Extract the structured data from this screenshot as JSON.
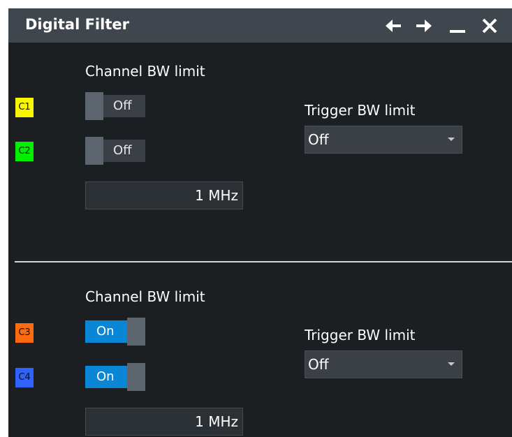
{
  "window": {
    "title": "Digital Filter",
    "icons": [
      "arrow-left-icon",
      "arrow-right-icon",
      "minimize-icon",
      "close-icon"
    ]
  },
  "colors": {
    "background": "#1c1f22",
    "titlebar": "#40464d",
    "toggle_on": "#0a86d6",
    "C1": "#f7f700",
    "C2": "#00f000",
    "C3": "#ff6a0f",
    "C4": "#2f62ff"
  },
  "groups": [
    {
      "channel_bw_label": "Channel BW limit",
      "channels": [
        {
          "name": "C1",
          "state": "Off"
        },
        {
          "name": "C2",
          "state": "Off"
        }
      ],
      "bw_value": "1 MHz",
      "trigger_bw_label": "Trigger BW limit",
      "trigger_bw_value": "Off"
    },
    {
      "channel_bw_label": "Channel BW limit",
      "channels": [
        {
          "name": "C3",
          "state": "On"
        },
        {
          "name": "C4",
          "state": "On"
        }
      ],
      "bw_value": "1 MHz",
      "trigger_bw_label": "Trigger BW limit",
      "trigger_bw_value": "Off"
    }
  ]
}
